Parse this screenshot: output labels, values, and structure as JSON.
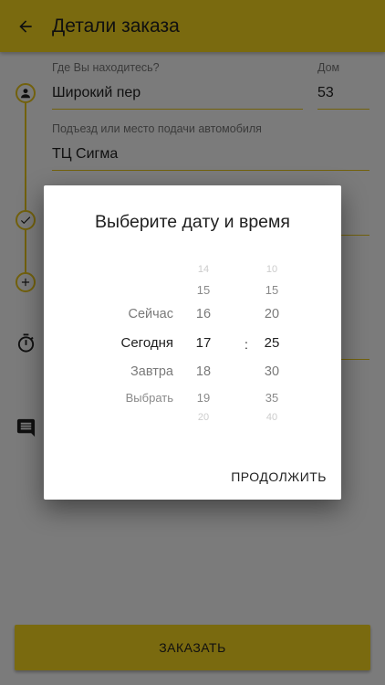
{
  "appbar": {
    "title": "Детали заказа",
    "back_icon": "arrow-back-icon"
  },
  "form": {
    "location_label": "Где Вы находитесь?",
    "location_value": "Широкий пер",
    "house_label": "Дом",
    "house_value": "53",
    "entrance_label": "Подъезд или место подачи автомобиля",
    "entrance_value": "ТЦ Сигма"
  },
  "dialog": {
    "title": "Выберите дату и время",
    "day_options": [
      "Сейчас",
      "Сегодня",
      "Завтра",
      "Выбрать"
    ],
    "selected_day": "Сегодня",
    "hours": [
      "14",
      "15",
      "16",
      "17",
      "18",
      "19",
      "20"
    ],
    "selected_hour": "17",
    "minutes": [
      "10",
      "15",
      "20",
      "25",
      "30",
      "35",
      "40"
    ],
    "selected_minute": "25",
    "separator": ":",
    "continue_label": "ПРОДОЛЖИТЬ"
  },
  "order_button": {
    "label": "ЗАКАЗАТЬ"
  },
  "colors": {
    "accent": "#f4d41e",
    "scrim": "rgba(0,0,0,0.5)"
  }
}
